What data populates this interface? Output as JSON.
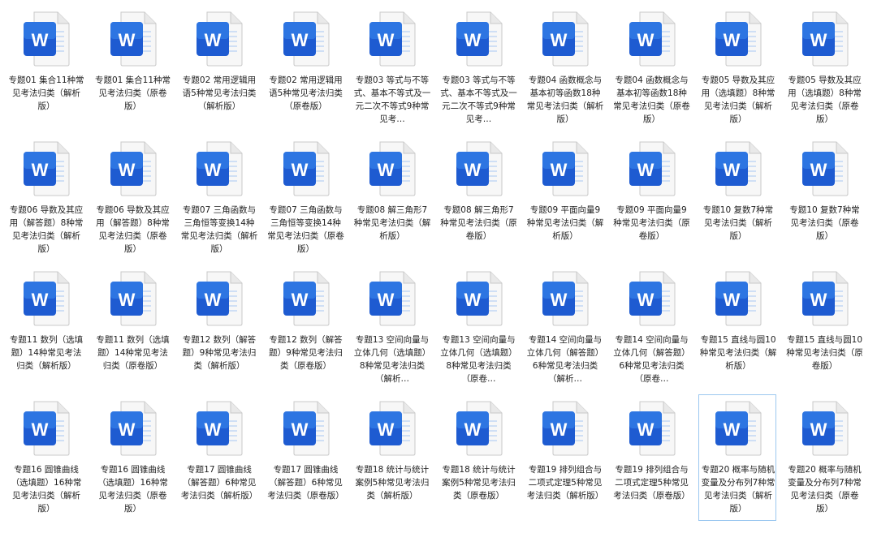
{
  "files": [
    {
      "name": "专题01 集合11种常见考法归类（解析版）",
      "selected": false
    },
    {
      "name": "专题01 集合11种常见考法归类（原卷版）",
      "selected": false
    },
    {
      "name": "专题02 常用逻辑用语5种常见考法归类（解析版）",
      "selected": false
    },
    {
      "name": "专题02 常用逻辑用语5种常见考法归类（原卷版）",
      "selected": false
    },
    {
      "name": "专题03 等式与不等式、基本不等式及一元二次不等式9种常见考…",
      "selected": false
    },
    {
      "name": "专题03 等式与不等式、基本不等式及一元二次不等式9种常见考…",
      "selected": false
    },
    {
      "name": "专题04 函数概念与基本初等函数18种常见考法归类（解析版）",
      "selected": false
    },
    {
      "name": "专题04 函数概念与基本初等函数18种常见考法归类（原卷版）",
      "selected": false
    },
    {
      "name": "专题05 导数及其应用（选填题）8种常见考法归类（解析版）",
      "selected": false
    },
    {
      "name": "专题05 导数及其应用（选填题）8种常见考法归类（原卷版）",
      "selected": false
    },
    {
      "name": "专题06 导数及其应用（解答题）8种常见考法归类（解析版）",
      "selected": false
    },
    {
      "name": "专题06 导数及其应用（解答题）8种常见考法归类（原卷版）",
      "selected": false
    },
    {
      "name": "专题07 三角函数与三角恒等变换14种常见考法归类（解析版）",
      "selected": false
    },
    {
      "name": "专题07 三角函数与三角恒等变换14种常见考法归类（原卷版）",
      "selected": false
    },
    {
      "name": "专题08 解三角形7种常见考法归类（解析版）",
      "selected": false
    },
    {
      "name": "专题08 解三角形7种常见考法归类（原卷版）",
      "selected": false
    },
    {
      "name": "专题09 平面向量9种常见考法归类（解析版）",
      "selected": false
    },
    {
      "name": "专题09 平面向量9种常见考法归类（原卷版）",
      "selected": false
    },
    {
      "name": "专题10 复数7种常见考法归类（解析版）",
      "selected": false
    },
    {
      "name": "专题10 复数7种常见考法归类（原卷版）",
      "selected": false
    },
    {
      "name": "专题11 数列（选填题）14种常见考法归类（解析版）",
      "selected": false
    },
    {
      "name": "专题11 数列（选填题）14种常见考法归类（原卷版）",
      "selected": false
    },
    {
      "name": "专题12 数列（解答题）9种常见考法归类（解析版）",
      "selected": false
    },
    {
      "name": "专题12 数列（解答题）9种常见考法归类（原卷版）",
      "selected": false
    },
    {
      "name": "专题13 空间向量与立体几何（选填题）8种常见考法归类（解析…",
      "selected": false
    },
    {
      "name": "专题13 空间向量与立体几何（选填题）8种常见考法归类（原卷…",
      "selected": false
    },
    {
      "name": "专题14 空间向量与立体几何（解答题）6种常见考法归类（解析…",
      "selected": false
    },
    {
      "name": "专题14 空间向量与立体几何（解答题）6种常见考法归类（原卷…",
      "selected": false
    },
    {
      "name": "专题15 直线与圆10种常见考法归类（解析版）",
      "selected": false
    },
    {
      "name": "专题15 直线与圆10种常见考法归类（原卷版）",
      "selected": false
    },
    {
      "name": "专题16 圆锥曲线（选填题）16种常见考法归类（解析版）",
      "selected": false
    },
    {
      "name": "专题16 圆锥曲线（选填题）16种常见考法归类（原卷版）",
      "selected": false
    },
    {
      "name": "专题17 圆锥曲线（解答题）6种常见考法归类（解析版）",
      "selected": false
    },
    {
      "name": "专题17 圆锥曲线（解答题）6种常见考法归类（原卷版）",
      "selected": false
    },
    {
      "name": "专题18 统计与统计案例5种常见考法归类（解析版）",
      "selected": false
    },
    {
      "name": "专题18 统计与统计案例5种常见考法归类（原卷版）",
      "selected": false
    },
    {
      "name": "专题19 排列组合与二项式定理5种常见考法归类（解析版）",
      "selected": false
    },
    {
      "name": "专题19 排列组合与二项式定理5种常见考法归类（原卷版）",
      "selected": false
    },
    {
      "name": "专题20 概率与随机变量及分布列7种常见考法归类（解析版）",
      "selected": true
    },
    {
      "name": "专题20 概率与随机变量及分布列7种常见考法归类（原卷版）",
      "selected": false
    }
  ],
  "icon": {
    "type": "word-document-icon",
    "letter": "W",
    "brand_color": "#1e5bd1",
    "highlight_color": "#3b8bf0"
  }
}
